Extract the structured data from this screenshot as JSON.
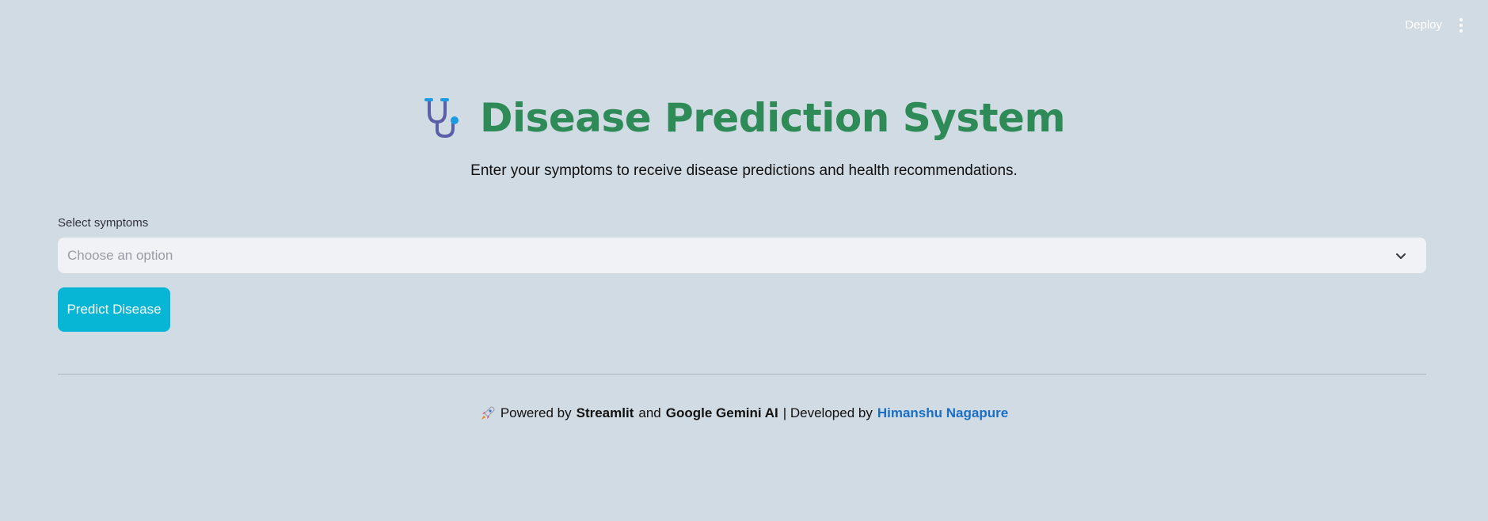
{
  "topbar": {
    "deploy_label": "Deploy"
  },
  "header": {
    "title": "Disease Prediction System",
    "icon": "stethoscope-icon"
  },
  "subtitle": "Enter your symptoms to receive disease predictions and health recommendations.",
  "symptoms": {
    "label": "Select symptoms",
    "placeholder": "Choose an option"
  },
  "predict_button": "Predict Disease",
  "footer": {
    "icon": "rocket-icon",
    "powered_by": "Powered by",
    "streamlit": "Streamlit",
    "and": "and",
    "gemini": "Google Gemini AI",
    "developed_by": "| Developed by",
    "author": "Himanshu Nagapure"
  },
  "colors": {
    "background": "#d1dbe3",
    "title": "#2e8b57",
    "button": "#06b6d4",
    "link": "#1a6fc4"
  }
}
